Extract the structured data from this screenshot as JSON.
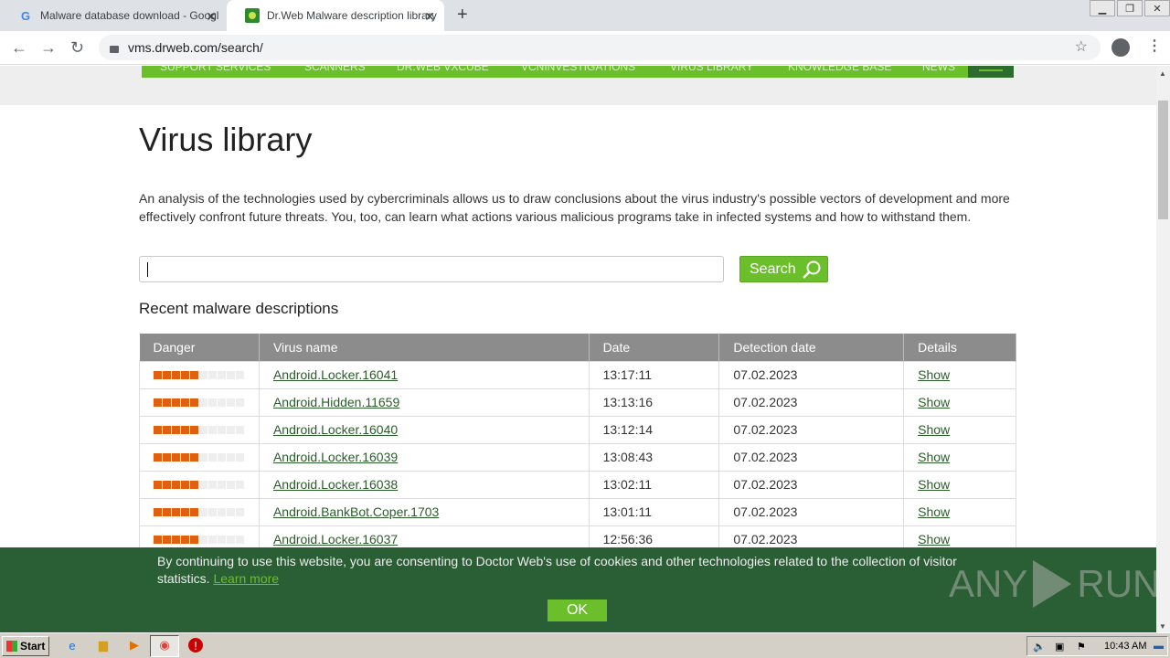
{
  "browser": {
    "tabs": [
      {
        "title": "Malware database download - Googl",
        "favicon": "google-g-icon"
      },
      {
        "title": "Dr.Web Malware description library",
        "favicon": "drweb-spider-icon"
      }
    ],
    "url": "vms.drweb.com/search/"
  },
  "site": {
    "topnav": [
      "SUPPORT SERVICES",
      "SCANNERS",
      "DR.WEB VXCUBE",
      "VCNINVESTIGATIONS",
      "VIRUS LIBRARY",
      "KNOWLEDGE BASE",
      "NEWS"
    ],
    "title": "Virus library",
    "intro": "An analysis of the technologies used by cybercriminals allows us to draw conclusions about the virus industry's possible vectors of development and more effectively confront future threats. You, too, can learn what actions various malicious programs take in infected systems and how to withstand them.",
    "search_button": "Search",
    "search_value": "",
    "recent_heading": "Recent malware descriptions",
    "table": {
      "headers": [
        "Danger",
        "Virus name",
        "Date",
        "Detection date",
        "Details"
      ],
      "rows": [
        {
          "danger": 5,
          "name": "Android.Locker.16041",
          "time": "13:17:11",
          "date": "07.02.2023",
          "details": "Show"
        },
        {
          "danger": 5,
          "name": "Android.Hidden.11659",
          "time": "13:13:16",
          "date": "07.02.2023",
          "details": "Show"
        },
        {
          "danger": 5,
          "name": "Android.Locker.16040",
          "time": "13:12:14",
          "date": "07.02.2023",
          "details": "Show"
        },
        {
          "danger": 5,
          "name": "Android.Locker.16039",
          "time": "13:08:43",
          "date": "07.02.2023",
          "details": "Show"
        },
        {
          "danger": 5,
          "name": "Android.Locker.16038",
          "time": "13:02:11",
          "date": "07.02.2023",
          "details": "Show"
        },
        {
          "danger": 5,
          "name": "Android.BankBot.Coper.1703",
          "time": "13:01:11",
          "date": "07.02.2023",
          "details": "Show"
        },
        {
          "danger": 5,
          "name": "Android.Locker.16037",
          "time": "12:56:36",
          "date": "07.02.2023",
          "details": "Show"
        }
      ]
    },
    "cookie": {
      "text": "By continuing to use this website, you are consenting to Doctor Web's use of cookies and other technologies related to the collection of visitor statistics.",
      "link": "Learn more",
      "ok": "OK"
    },
    "watermark": "ANY RUN"
  },
  "colors": {
    "brand_green": "#6abf2a",
    "danger_orange": "#e06010",
    "cookie_bg": "#2a5e34"
  },
  "taskbar": {
    "start": "Start",
    "clock": "10:43 AM"
  }
}
